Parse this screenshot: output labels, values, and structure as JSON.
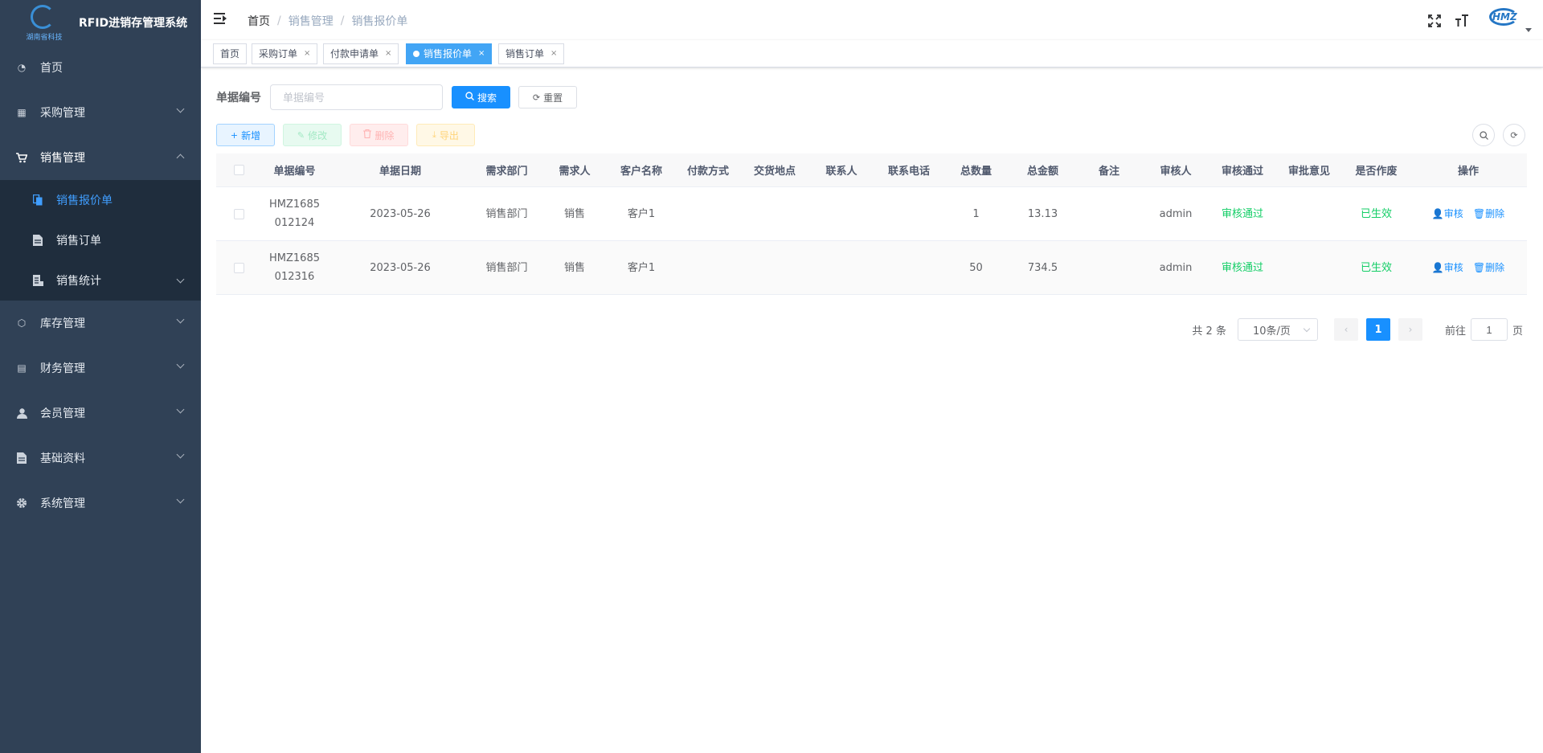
{
  "app": {
    "title": "RFID进销存管理系统",
    "logo_text": "湖南省科技"
  },
  "sidebar": {
    "items": [
      {
        "label": "首页",
        "icon": "dashboard-icon",
        "expandable": false
      },
      {
        "label": "采购管理",
        "icon": "table-icon",
        "expandable": true
      },
      {
        "label": "销售管理",
        "icon": "cart-icon",
        "expandable": true,
        "open": true
      },
      {
        "label": "库存管理",
        "icon": "box-icon",
        "expandable": true
      },
      {
        "label": "财务管理",
        "icon": "finance-icon",
        "expandable": true
      },
      {
        "label": "会员管理",
        "icon": "user-icon",
        "expandable": true
      },
      {
        "label": "基础资料",
        "icon": "document-icon",
        "expandable": true
      },
      {
        "label": "系统管理",
        "icon": "gear-icon",
        "expandable": true
      }
    ],
    "sub_items": [
      {
        "label": "销售报价单",
        "active": true,
        "icon": "copy-icon"
      },
      {
        "label": "销售订单",
        "active": false,
        "icon": "file-icon"
      },
      {
        "label": "销售统计",
        "active": false,
        "icon": "chart-icon",
        "expandable": true
      }
    ]
  },
  "header": {
    "breadcrumb": [
      "首页",
      "销售管理",
      "销售报价单"
    ],
    "avatar_text": "HMZ"
  },
  "tags": [
    {
      "label": "首页",
      "closable": false,
      "active": false
    },
    {
      "label": "采购订单",
      "closable": true,
      "active": false
    },
    {
      "label": "付款申请单",
      "closable": true,
      "active": false
    },
    {
      "label": "销售报价单",
      "closable": true,
      "active": true
    },
    {
      "label": "销售订单",
      "closable": true,
      "active": false
    }
  ],
  "search": {
    "label": "单据编号",
    "placeholder": "单据编号",
    "search_button": "搜索",
    "reset_button": "重置"
  },
  "toolbar": {
    "add": "新增",
    "edit": "修改",
    "delete": "删除",
    "export": "导出"
  },
  "table": {
    "columns": [
      "单据编号",
      "单据日期",
      "需求部门",
      "需求人",
      "客户名称",
      "付款方式",
      "交货地点",
      "联系人",
      "联系电话",
      "总数量",
      "总金额",
      "备注",
      "审核人",
      "审核通过",
      "审批意见",
      "是否作废",
      "操作"
    ],
    "rows": [
      {
        "code_line1": "HMZ1685",
        "code_line2": "012124",
        "date": "2023-05-26",
        "dept": "销售部门",
        "person": "销售",
        "customer": "客户1",
        "payment": "",
        "delivery": "",
        "contact": "",
        "phone": "",
        "qty": "1",
        "amount": "13.13",
        "remark": "",
        "auditor": "admin",
        "audit_status": "审核通过",
        "opinion": "",
        "void_status": "已生效",
        "action_audit": "审核",
        "action_delete": "删除"
      },
      {
        "code_line1": "HMZ1685",
        "code_line2": "012316",
        "date": "2023-05-26",
        "dept": "销售部门",
        "person": "销售",
        "customer": "客户1",
        "payment": "",
        "delivery": "",
        "contact": "",
        "phone": "",
        "qty": "50",
        "amount": "734.5",
        "remark": "",
        "auditor": "admin",
        "audit_status": "审核通过",
        "opinion": "",
        "void_status": "已生效",
        "action_audit": "审核",
        "action_delete": "删除"
      }
    ]
  },
  "pagination": {
    "total": "共 2 条",
    "page_size": "10条/页",
    "current_page": "1",
    "goto_prefix": "前往",
    "goto_value": "1",
    "goto_suffix": "页"
  },
  "colors": {
    "sidebar_bg": "#304156",
    "submenu_bg": "#1f2d3d",
    "primary": "#1890ff",
    "active_tag": "#42a5f5",
    "success": "#13ce66"
  }
}
